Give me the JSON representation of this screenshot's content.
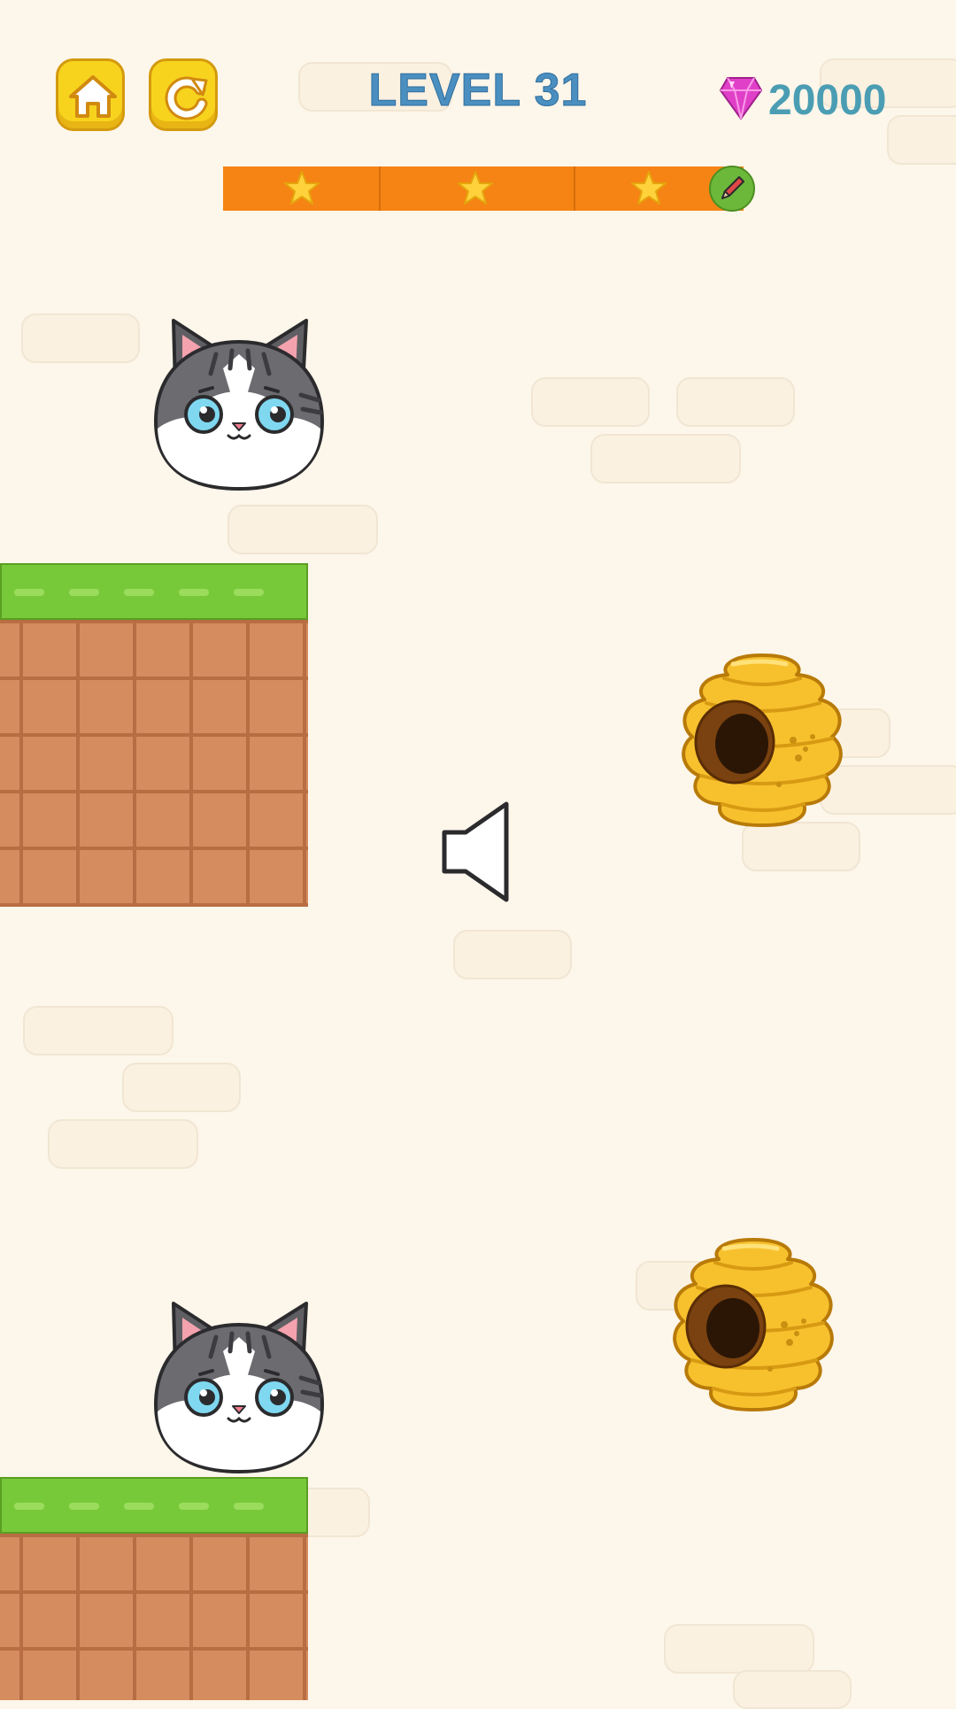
{
  "header": {
    "level_title": "LEVEL 31",
    "gems": "20000",
    "home_icon": "home-icon",
    "restart_icon": "restart-icon",
    "gem_icon": "pink-gem-icon"
  },
  "progress": {
    "stars_total": 3,
    "stars_earned": 3,
    "fill_fraction": 1.0,
    "tool_icon": "pencil-icon"
  },
  "scene": {
    "characters": [
      "cat",
      "cat"
    ],
    "hazards": [
      "beehive",
      "beehive"
    ],
    "center_icon": "speaker-icon"
  },
  "colors": {
    "background": "#fdf6ea",
    "title": "#4a8fc0",
    "gem_text": "#4a9db3",
    "progress_bar": "#f58414",
    "grass": "#78c93a",
    "dirt": "#d58c5f",
    "button": "#f7d31e"
  }
}
